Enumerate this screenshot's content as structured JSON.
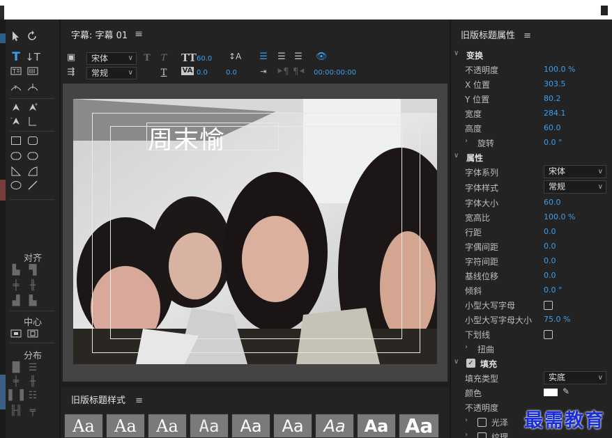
{
  "title_panel": {
    "title": "字幕: 字幕 01",
    "menu_icon": "hamburger-icon",
    "font_family": "宋体",
    "font_style": "常规",
    "font_size": "60.0",
    "leading": "0.0",
    "kerning": "0.0",
    "tracking": "0.0",
    "timecode": "00:00:00:00",
    "title_text": "周末愉"
  },
  "tools_panel": {
    "align_label": "对齐",
    "center_label": "中心",
    "distribute_label": "分布"
  },
  "styles_panel": {
    "title": "旧版标题样式",
    "swatches": [
      "Aa",
      "Aa",
      "Aa",
      "Aa",
      "Aa",
      "Aa",
      "Aa",
      "Aa",
      "Aa"
    ]
  },
  "properties": {
    "title": "旧版标题属性",
    "transform_label": "变换",
    "opacity_label": "不透明度",
    "opacity_value": "100.0 %",
    "xpos_label": "X 位置",
    "xpos_value": "303.5",
    "ypos_label": "Y 位置",
    "ypos_value": "80.2",
    "width_label": "宽度",
    "width_value": "284.1",
    "height_label": "高度",
    "height_value": "60.0",
    "rotation_label": "旋转",
    "rotation_value": "0.0 °",
    "attributes_label": "属性",
    "font_family_label": "字体系列",
    "font_family_value": "宋体",
    "font_style_label": "字体样式",
    "font_style_value": "常规",
    "font_size_label": "字体大小",
    "font_size_value": "60.0",
    "aspect_label": "宽高比",
    "aspect_value": "100.0 %",
    "leading_label": "行距",
    "leading_value": "0.0",
    "kerning_label": "字偶间距",
    "kerning_value": "0.0",
    "tracking_label": "字符间距",
    "tracking_value": "0.0",
    "baseline_label": "基线位移",
    "baseline_value": "0.0",
    "slant_label": "倾斜",
    "slant_value": "0.0 °",
    "smallcaps_label": "小型大写字母",
    "smallcaps_size_label": "小型大写字母大小",
    "smallcaps_size_value": "75.0 %",
    "underline_label": "下划线",
    "distort_label": "扭曲",
    "fill_label": "填充",
    "fill_type_label": "填充类型",
    "fill_type_value": "实底",
    "color_label": "颜色",
    "fill_color": "#ffffff",
    "fill_opacity_label": "不透明度",
    "sheen_label": "光泽",
    "texture_label": "纹理"
  },
  "watermark": "最需教育",
  "colors": {
    "accent": "#3aa0f0",
    "panel": "#232323",
    "watermark": "#1b2fd9"
  }
}
